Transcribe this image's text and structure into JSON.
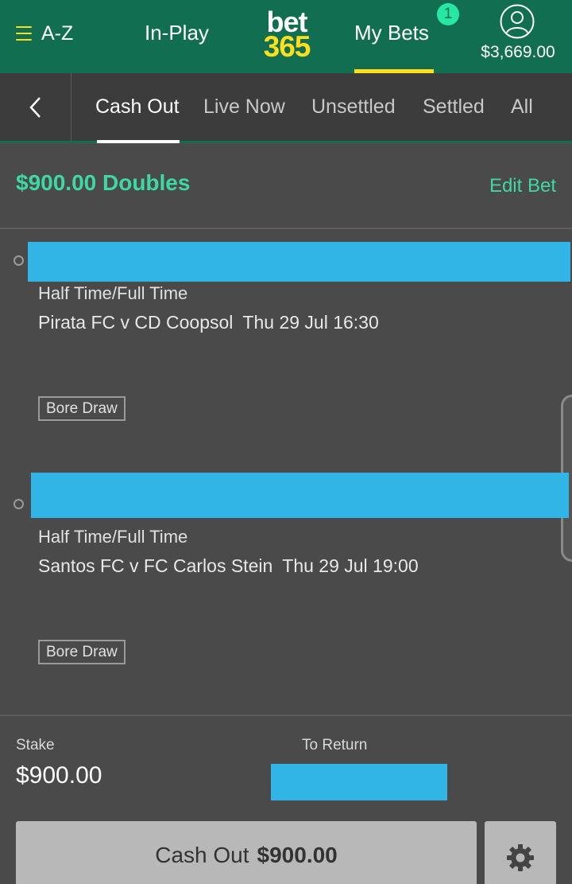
{
  "header": {
    "menu_label": "A-Z",
    "inplay_label": "In-Play",
    "logo_top": "bet",
    "logo_bottom": "365",
    "mybets_label": "My Bets",
    "mybets_badge": "1",
    "balance": "$3,669.00"
  },
  "tabs": [
    {
      "label": "Cash Out",
      "active": true
    },
    {
      "label": "Live Now",
      "active": false
    },
    {
      "label": "Unsettled",
      "active": false
    },
    {
      "label": "Settled",
      "active": false
    },
    {
      "label": "All",
      "active": false
    }
  ],
  "bet": {
    "title": "$900.00 Doubles",
    "edit_label": "Edit Bet",
    "selections": [
      {
        "market": "Half Time/Full Time",
        "fixture": "Pirata FC v CD Coopsol",
        "datetime": "Thu 29 Jul 16:30",
        "tag": "Bore Draw"
      },
      {
        "market": "Half Time/Full Time",
        "fixture": "Santos FC v FC Carlos Stein",
        "datetime": "Thu 29 Jul 19:00",
        "tag": "Bore Draw"
      }
    ],
    "stake_label": "Stake",
    "stake_value": "$900.00",
    "return_label": "To Return",
    "cashout_label": "Cash Out",
    "cashout_amount": "$900.00"
  },
  "colors": {
    "header_green": "#126e51",
    "accent_yellow": "#ffdf1b",
    "accent_teal": "#3ed8a5",
    "redaction": "#31b4e6"
  },
  "icons": {
    "menu": "hamburger-icon",
    "account": "account-icon",
    "back": "chevron-left-icon",
    "settings": "gear-icon"
  }
}
